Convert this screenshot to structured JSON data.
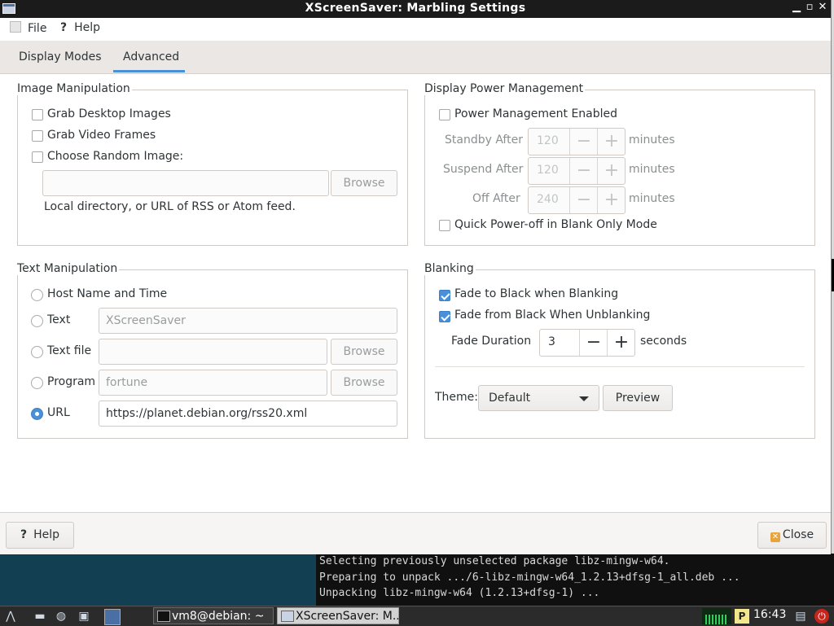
{
  "window": {
    "title": "XScreenSaver: Marbling Settings"
  },
  "menu": {
    "file": "File",
    "help": "Help"
  },
  "tabs": [
    {
      "label": "Display Modes"
    },
    {
      "label": "Advanced"
    }
  ],
  "image_manipulation": {
    "title": "Image Manipulation",
    "grab_desktop": "Grab Desktop Images",
    "grab_video": "Grab Video Frames",
    "choose_random": "Choose Random Image:",
    "path_value": "",
    "browse": "Browse",
    "hint": "Local directory, or URL of RSS or Atom feed."
  },
  "text_manipulation": {
    "title": "Text Manipulation",
    "host_name": "Host Name and Time",
    "text_label": "Text",
    "text_value": "XScreenSaver",
    "file_label": "Text file",
    "file_value": "",
    "program_label": "Program",
    "program_value": "fortune",
    "url_label": "URL",
    "url_value": "https://planet.debian.org/rss20.xml",
    "browse": "Browse"
  },
  "power": {
    "title": "Display Power Management",
    "enabled": "Power Management Enabled",
    "standby_label": "Standby After",
    "standby_value": "120",
    "suspend_label": "Suspend After",
    "suspend_value": "120",
    "off_label": "Off After",
    "off_value": "240",
    "unit": "minutes",
    "quick_off": "Quick Power-off in Blank Only Mode"
  },
  "blanking": {
    "title": "Blanking",
    "fade_to_black": "Fade to Black when Blanking",
    "fade_from_black": "Fade from Black When Unblanking",
    "fade_duration_label": "Fade Duration",
    "fade_duration_value": "3",
    "fade_unit": "seconds",
    "theme_label": "Theme:",
    "theme_value": "Default",
    "preview": "Preview"
  },
  "buttons": {
    "help": "Help",
    "close": "Close"
  },
  "terminal": {
    "lines": [
      "Selecting previously unselected package libz-mingw-w64.",
      "Preparing to unpack .../6-libz-mingw-w64_1.2.13+dfsg-1_all.deb ...",
      "Unpacking libz-mingw-w64 (1.2.13+dfsg-1) ..."
    ]
  },
  "taskbar": {
    "terminal_task": "vm8@debian: ~",
    "xscreensaver_task": "XScreenSaver: M...",
    "clock": "16:43"
  },
  "colors": {
    "accent": "#4a90d9",
    "titlebar": "#1b1b1b",
    "desktop": "#123f52"
  }
}
